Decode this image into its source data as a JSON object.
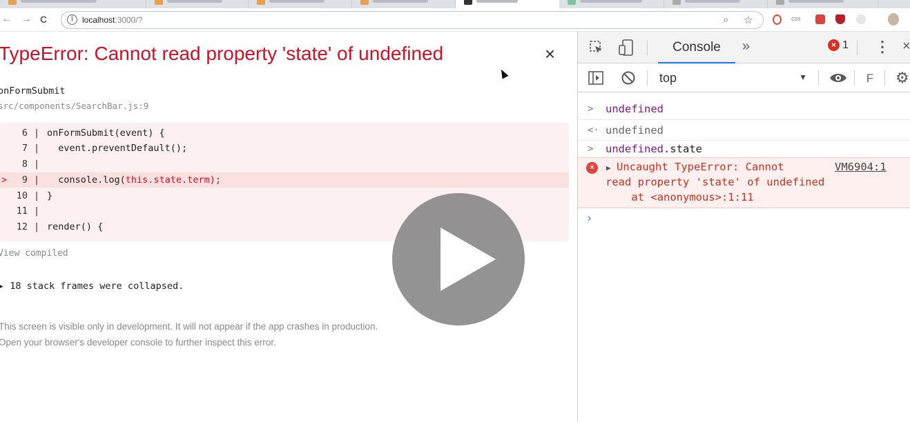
{
  "browser": {
    "address": {
      "host": "localhost",
      "rest": ":3000/?"
    },
    "nav": {
      "back": "←",
      "forward": "→",
      "reload": "C"
    }
  },
  "overlay": {
    "title": "TypeError: Cannot read property 'state' of undefined",
    "close": "×",
    "function_name": "onFormSubmit",
    "file_location": "src/components/SearchBar.js:9",
    "code_lines": [
      {
        "num": "6",
        "text": "onFormSubmit(event) {"
      },
      {
        "num": "7",
        "text": "  event.preventDefault();"
      },
      {
        "num": "8",
        "text": ""
      },
      {
        "num": "9",
        "text_before": "  console.log(",
        "text_red": "this.state.term);",
        "marker": ">"
      },
      {
        "num": "10",
        "text": "}"
      },
      {
        "num": "11",
        "text": ""
      },
      {
        "num": "12",
        "text": "render() {"
      }
    ],
    "view_compiled": "View compiled",
    "collapsed": "▸ 18 stack frames were collapsed.",
    "footnote_1": "This screen is visible only in development. It will not appear if the app crashes in production.",
    "footnote_2": "Open your browser's developer console to further inspect this error."
  },
  "devtools": {
    "tab_console": "Console",
    "more_tabs": "»",
    "error_count": "1",
    "context": "top",
    "filter_label": "F",
    "console": {
      "line1": "undefined",
      "line2": "undefined",
      "line3_a": "undefined",
      "line3_b": ".state",
      "error_line1": "Uncaught TypeError: Cannot",
      "error_line2": "read property 'state' of undefined",
      "error_line3": "    at <anonymous>:1:11",
      "error_source": "VM6904:1"
    }
  },
  "colors": {
    "error_red": "#ce1126",
    "console_purple": "#881391",
    "accent_blue": "#1a73e8"
  }
}
